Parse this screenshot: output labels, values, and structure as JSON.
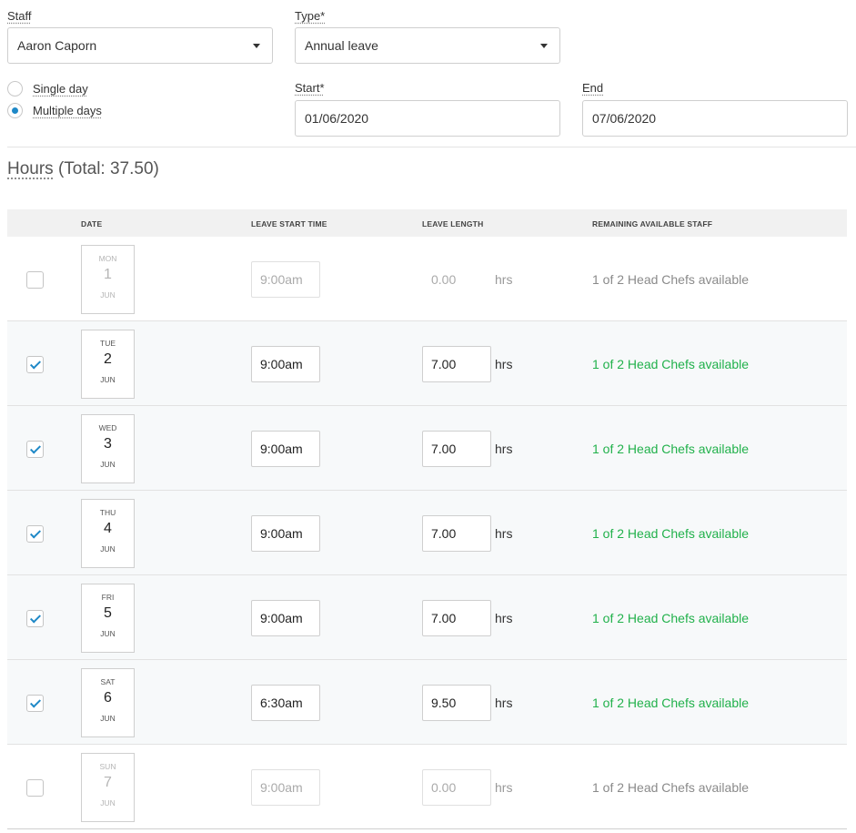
{
  "staff": {
    "label": "Staff",
    "value": "Aaron Caporn"
  },
  "type": {
    "label": "Type*",
    "value": "Annual leave"
  },
  "duration": {
    "single_label": "Single day",
    "multiple_label": "Multiple days",
    "selected": "multiple"
  },
  "start": {
    "label": "Start*",
    "value": "01/06/2020"
  },
  "end": {
    "label": "End",
    "value": "07/06/2020"
  },
  "hours": {
    "title": "Hours",
    "total_text": "(Total: 37.50)"
  },
  "table": {
    "headers": {
      "date": "DATE",
      "start_time": "LEAVE START TIME",
      "length": "LEAVE LENGTH",
      "remaining": "REMAINING AVAILABLE STAFF"
    },
    "rows": [
      {
        "checked": false,
        "dow": "MON",
        "day": "1",
        "month": "JUN",
        "start_time": "9:00am",
        "length": "0.00",
        "unit": "hrs",
        "availability": "1 of 2 Head Chefs available"
      },
      {
        "checked": true,
        "dow": "TUE",
        "day": "2",
        "month": "JUN",
        "start_time": "9:00am",
        "length": "7.00",
        "unit": "hrs",
        "availability": "1 of 2 Head Chefs available"
      },
      {
        "checked": true,
        "dow": "WED",
        "day": "3",
        "month": "JUN",
        "start_time": "9:00am",
        "length": "7.00",
        "unit": "hrs",
        "availability": "1 of 2 Head Chefs available"
      },
      {
        "checked": true,
        "dow": "THU",
        "day": "4",
        "month": "JUN",
        "start_time": "9:00am",
        "length": "7.00",
        "unit": "hrs",
        "availability": "1 of 2 Head Chefs available"
      },
      {
        "checked": true,
        "dow": "FRI",
        "day": "5",
        "month": "JUN",
        "start_time": "9:00am",
        "length": "7.00",
        "unit": "hrs",
        "availability": "1 of 2 Head Chefs available"
      },
      {
        "checked": true,
        "dow": "SAT",
        "day": "6",
        "month": "JUN",
        "start_time": "6:30am",
        "length": "9.50",
        "unit": "hrs",
        "availability": "1 of 2 Head Chefs available"
      },
      {
        "checked": false,
        "dow": "SUN",
        "day": "7",
        "month": "JUN",
        "start_time": "9:00am",
        "length": "0.00",
        "unit": "hrs",
        "availability": "1 of 2 Head Chefs available"
      }
    ]
  },
  "colors": {
    "accent": "#1e88c7",
    "available": "#21b14b",
    "inactive_text": "#8a8a8a"
  }
}
